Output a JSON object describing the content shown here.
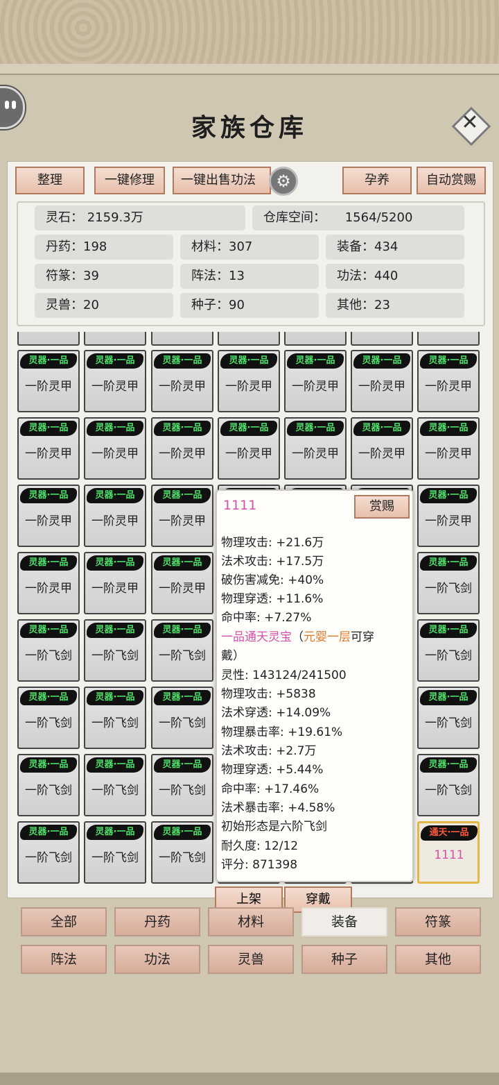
{
  "title": "家族仓库",
  "toolbar": {
    "sort": "整理",
    "repair": "一键修理",
    "sell": "一键出售功法",
    "nurture": "孕养",
    "auto_reward": "自动赏赐"
  },
  "stats": {
    "stone": "灵石：  2159.3万",
    "space_label": "仓库空间：",
    "space_value": "1564/5200",
    "pill": "丹药：198",
    "material": "材料：307",
    "equip": "装备：434",
    "talisman": "符篆：39",
    "formation": "阵法：13",
    "skill": "功法：440",
    "beast": "灵兽：20",
    "seed": "种子：90",
    "other": "其他：23"
  },
  "grid": {
    "tag": "灵器·一品",
    "armor": "一阶灵甲",
    "sword": "一阶飞剑",
    "selected_tag": "通天·一品",
    "selected_name": "1111"
  },
  "tooltip": {
    "name": "1111",
    "reward": "赏赐",
    "lines_a": [
      "物理攻击: +21.6万",
      "法术攻击: +17.5万",
      "破伤害减免: +40%",
      "物理穿透: +11.6%",
      "命中率: +7.27%"
    ],
    "grade": "一品通天灵宝",
    "paren_open": "（",
    "realm": "元婴一层",
    "wearable": "可穿",
    "wearable2": "戴）",
    "lines_b": [
      "灵性:  143124/241500",
      "物理攻击: +5838",
      "法术穿透: +14.09%",
      "物理暴击率: +19.61%",
      "法术攻击: +2.7万",
      "物理穿透: +5.44%",
      "命中率: +17.46%",
      "法术暴击率: +4.58%",
      "初始形态是六阶飞剑",
      "耐久度:  12/12",
      "评分:  871398"
    ]
  },
  "actions": {
    "list": "上架",
    "wear": "穿戴"
  },
  "categories": [
    "全部",
    "丹药",
    "材料",
    "装备",
    "符篆",
    "阵法",
    "功法",
    "灵兽",
    "种子",
    "其他"
  ],
  "active_category": "装备"
}
